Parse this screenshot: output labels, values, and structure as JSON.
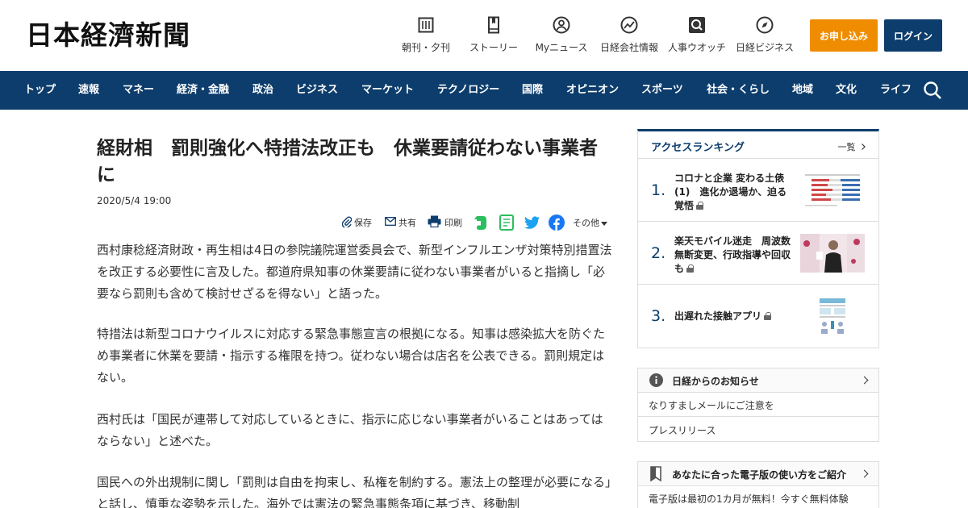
{
  "header": {
    "logo": "日本経濟新聞",
    "nav": [
      {
        "label": "朝刊・夕刊",
        "icon": "newspaper-icon"
      },
      {
        "label": "ストーリー",
        "icon": "book-icon"
      },
      {
        "label": "Myニュース",
        "icon": "person-icon"
      },
      {
        "label": "日経会社情報",
        "icon": "chart-icon"
      },
      {
        "label": "人事ウオッチ",
        "icon": "search-person-icon"
      },
      {
        "label": "日経ビジネス",
        "icon": "compass-icon"
      }
    ],
    "subscribe": "お申し込み",
    "login": "ログイン"
  },
  "menu": [
    "トップ",
    "速報",
    "マネー",
    "経済・金融",
    "政治",
    "ビジネス",
    "マーケット",
    "テクノロジー",
    "国際",
    "オピニオン",
    "スポーツ",
    "社会・くらし",
    "地域",
    "文化",
    "ライフ"
  ],
  "article": {
    "title": "経財相　罰則強化へ特措法改正も　休業要請従わない事業者に",
    "date": "2020/5/4 19:00",
    "share": {
      "save": "保存",
      "share": "共有",
      "print": "印刷",
      "other": "その他"
    },
    "paragraphs": [
      "西村康稔経済財政・再生相は4日の参院議院運営委員会で、新型インフルエンザ対策特別措置法を改正する必要性に言及した。都道府県知事の休業要請に従わない事業者がいると指摘し「必要なら罰則も含めて検討せざるを得ない」と語った。",
      "特措法は新型コロナウイルスに対応する緊急事態宣言の根拠になる。知事は感染拡大を防ぐため事業者に休業を要請・指示する権限を持つ。従わない場合は店名を公表できる。罰則規定はない。",
      "西村氏は「国民が連帯して対応しているときに、指示に応じない事業者がいることはあってはならない」と述べた。",
      "国民への外出規制に関し「罰則は自由を拘束し、私権を制約する。憲法上の整理が必要になる」と話し、慎重な姿勢を示した。海外では憲法の緊急事態条項に基づき、移動制"
    ]
  },
  "ranking": {
    "title": "アクセスランキング",
    "more": "一覧",
    "items": [
      {
        "num": "1.",
        "text": "コロナと企業 変わる土俵(1)　進化か退場か、迫る覚悟"
      },
      {
        "num": "2.",
        "text": "楽天モバイル迷走　周波数無断変更、行政指導や回収も"
      },
      {
        "num": "3.",
        "text": "出遅れた接触アプリ"
      }
    ]
  },
  "info": {
    "title": "日経からのお知らせ",
    "items": [
      "なりすましメールにご注意を",
      "プレスリリース"
    ]
  },
  "promo": {
    "title": "あなたに合った電子版の使い方をご紹介",
    "text": "電子版は最初の1カ月が無料！今すぐ無料体験"
  },
  "colors": {
    "navy": "#0d3d6c",
    "orange": "#f08c00"
  }
}
